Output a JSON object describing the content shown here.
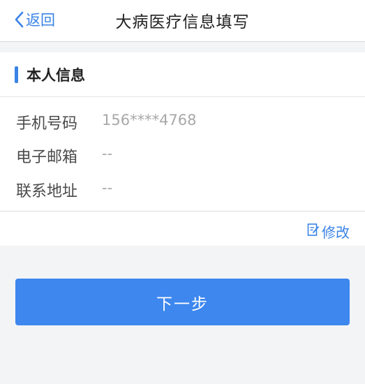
{
  "header": {
    "back_label": "返回",
    "title": "大病医疗信息填写"
  },
  "section": {
    "title": "本人信息",
    "accent_color": "#3a83e6"
  },
  "fields": [
    {
      "label": "手机号码",
      "value": "156****4768"
    },
    {
      "label": "电子邮箱",
      "value": "--"
    },
    {
      "label": "联系地址",
      "value": "--"
    }
  ],
  "actions": {
    "edit_label": "修改",
    "next_label": "下一步"
  },
  "icons": {
    "back": "chevron-left-icon",
    "edit": "edit-icon"
  },
  "colors": {
    "primary": "#3d87ee",
    "background": "#f3f4f6"
  }
}
